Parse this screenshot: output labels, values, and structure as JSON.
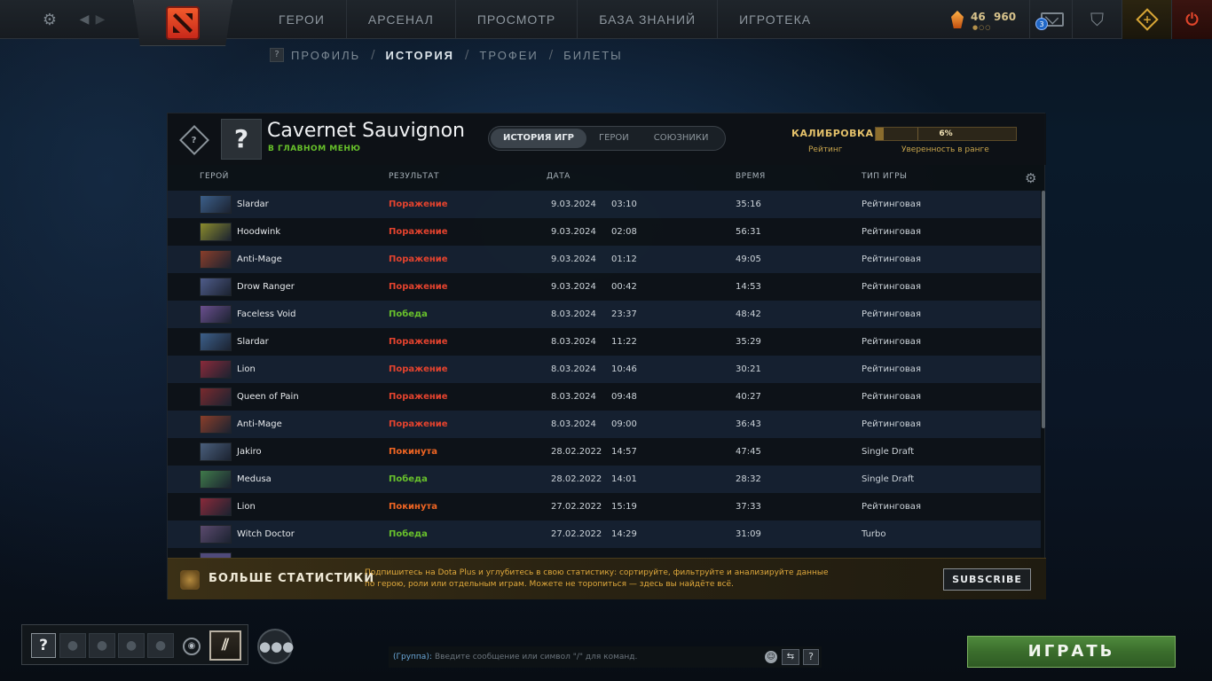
{
  "topbar": {
    "nav": [
      "ГЕРОИ",
      "АРСЕНАЛ",
      "ПРОСМОТР",
      "БАЗА ЗНАНИЙ",
      "ИГРОТЕКА"
    ],
    "currency": {
      "level": "46",
      "amount": "960"
    },
    "mail_count": "3"
  },
  "subnav": {
    "help": "?",
    "tabs": [
      "ПРОФИЛЬ",
      "ИСТОРИЯ",
      "ТРОФЕИ",
      "БИЛЕТЫ"
    ],
    "active": "ИСТОРИЯ"
  },
  "profile": {
    "avatar": "?",
    "name": "Cavernet Sauvignon",
    "status": "В ГЛАВНОМ МЕНЮ",
    "views": [
      "ИСТОРИЯ ИГР",
      "ГЕРОИ",
      "СОЮЗНИКИ"
    ],
    "active_view": "ИСТОРИЯ ИГР",
    "calibration_label": "КАЛИБРОВКА",
    "rating_label": "Рейтинг",
    "confidence_value": "6%",
    "confidence_percent": 6,
    "confidence_label": "Уверенность в ранге"
  },
  "table": {
    "headers": {
      "hero": "ГЕРОЙ",
      "result": "РЕЗУЛЬТАТ",
      "date": "ДАТА",
      "time": "ВРЕМЯ",
      "type": "ТИП ИГРЫ"
    },
    "rows": [
      {
        "hero": "Slardar",
        "result": "Поражение",
        "outcome": "loss",
        "date": "9.03.2024",
        "clock": "03:10",
        "duration": "35:16",
        "type": "Рейтинговая",
        "color": "#3c5f8a"
      },
      {
        "hero": "Hoodwink",
        "result": "Поражение",
        "outcome": "loss",
        "date": "9.03.2024",
        "clock": "02:08",
        "duration": "56:31",
        "type": "Рейтинговая",
        "color": "#8a8b2c"
      },
      {
        "hero": "Anti-Mage",
        "result": "Поражение",
        "outcome": "loss",
        "date": "9.03.2024",
        "clock": "01:12",
        "duration": "49:05",
        "type": "Рейтинговая",
        "color": "#8a3e2a"
      },
      {
        "hero": "Drow Ranger",
        "result": "Поражение",
        "outcome": "loss",
        "date": "9.03.2024",
        "clock": "00:42",
        "duration": "14:53",
        "type": "Рейтинговая",
        "color": "#4f5c8a"
      },
      {
        "hero": "Faceless Void",
        "result": "Победа",
        "outcome": "win",
        "date": "8.03.2024",
        "clock": "23:37",
        "duration": "48:42",
        "type": "Рейтинговая",
        "color": "#6a4f8e"
      },
      {
        "hero": "Slardar",
        "result": "Поражение",
        "outcome": "loss",
        "date": "8.03.2024",
        "clock": "11:22",
        "duration": "35:29",
        "type": "Рейтинговая",
        "color": "#3c5f8a"
      },
      {
        "hero": "Lion",
        "result": "Поражение",
        "outcome": "loss",
        "date": "8.03.2024",
        "clock": "10:46",
        "duration": "30:21",
        "type": "Рейтинговая",
        "color": "#8a2a3a"
      },
      {
        "hero": "Queen of Pain",
        "result": "Поражение",
        "outcome": "loss",
        "date": "8.03.2024",
        "clock": "09:48",
        "duration": "40:27",
        "type": "Рейтинговая",
        "color": "#7a2a2e"
      },
      {
        "hero": "Anti-Mage",
        "result": "Поражение",
        "outcome": "loss",
        "date": "8.03.2024",
        "clock": "09:00",
        "duration": "36:43",
        "type": "Рейтинговая",
        "color": "#8a3e2a"
      },
      {
        "hero": "Jakiro",
        "result": "Покинута",
        "outcome": "abandon",
        "date": "28.02.2022",
        "clock": "14:57",
        "duration": "47:45",
        "type": "Single Draft",
        "color": "#4a5f7c"
      },
      {
        "hero": "Medusa",
        "result": "Победа",
        "outcome": "win",
        "date": "28.02.2022",
        "clock": "14:01",
        "duration": "28:32",
        "type": "Single Draft",
        "color": "#3f7a4a"
      },
      {
        "hero": "Lion",
        "result": "Покинута",
        "outcome": "abandon",
        "date": "27.02.2022",
        "clock": "15:19",
        "duration": "37:33",
        "type": "Рейтинговая",
        "color": "#8a2a3a"
      },
      {
        "hero": "Witch Doctor",
        "result": "Победа",
        "outcome": "win",
        "date": "27.02.2022",
        "clock": "14:29",
        "duration": "31:09",
        "type": "Turbo",
        "color": "#5b4a6e"
      }
    ]
  },
  "promo": {
    "title": "БОЛЬШЕ СТАТИСТИКИ",
    "text": "Подпишитесь на Dota Plus и углубитесь в свою статистику: сортируйте, фильтруйте и анализируйте данные по герою, роли или отдельным играм. Можете не торопиться — здесь вы найдёте всё.",
    "button": "SUBSCRIBE"
  },
  "bottom": {
    "party_help": "?",
    "chat_channel": "(Группа):",
    "chat_placeholder": "Введите сообщение или символ \"/\" для команд.",
    "chat_help": "?",
    "play": "ИГРАТЬ"
  },
  "colors": {
    "loss": "#e4432e",
    "win": "#68c12c",
    "abandon": "#ef6523",
    "accent_gold": "#e4c16a",
    "play_green": "#3a6d2c"
  },
  "icons": [
    "settings-gear-icon",
    "back-arrow-icon",
    "forward-arrow-icon",
    "dota-logo",
    "shard-currency-icon",
    "mail-icon",
    "armory-icon",
    "dota-plus-icon",
    "power-icon",
    "rank-medal-icon",
    "table-settings-icon",
    "voice-icon",
    "battlepass-icon",
    "friends-icon",
    "emoji-icon",
    "chatwheel-icon"
  ]
}
